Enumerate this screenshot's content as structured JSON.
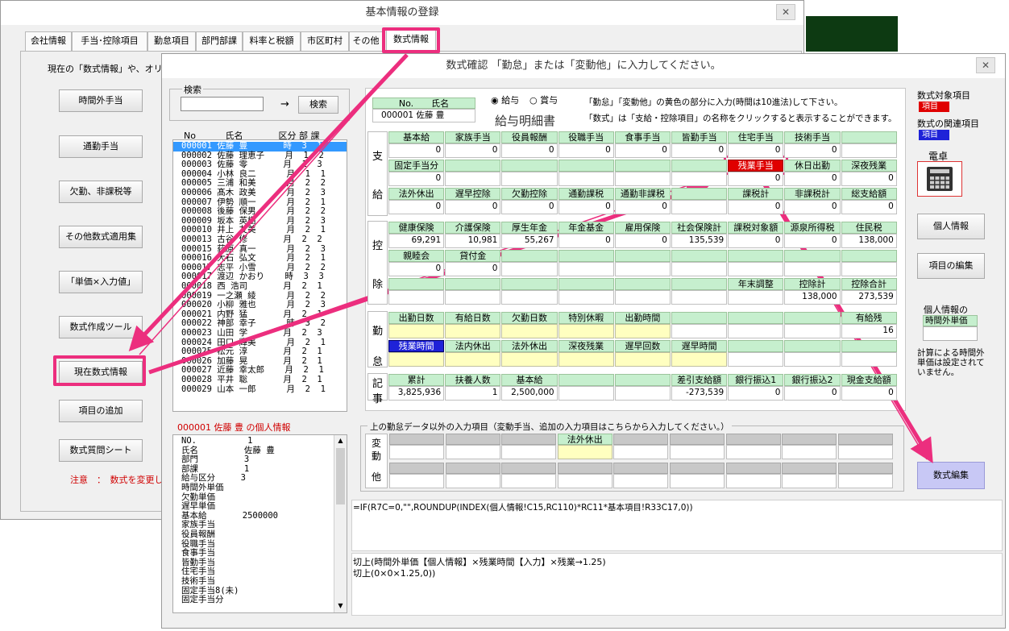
{
  "back_window": {
    "title": "基本情報の登録",
    "tabs": [
      "会社情報",
      "手当･控除項目",
      "勤怠項目",
      "部門部課",
      "料率と税額",
      "市区町村",
      "その他",
      "数式情報"
    ],
    "intro": "現在の「数式情報」や、オリジ",
    "buttons": [
      "時間外手当",
      "通勤手当",
      "欠勤、非課税等",
      "その他数式適用集",
      "｢単価×入力値｣",
      "数式作成ツール",
      "現在数式情報",
      "項目の追加",
      "数式質問シート"
    ],
    "note": "注意　：　数式を変更し"
  },
  "dialog": {
    "title": "数式確認 「勤怠」または「変動他」に入力してください。",
    "close": "✕",
    "search_label": "検索",
    "search_value": "",
    "arrow": "→",
    "search_button": "検索",
    "list_header": "No　　　 氏名　　　　区分 部 課",
    "employees": [
      "000001 佐藤 豊       時  3  1",
      "000002 佐藤 理恵子    月  1  2",
      "000003 佐藤 零       月  1  3",
      "000004 小林 良二      月  1  1",
      "000005 三浦 和美      月  2  2",
      "000006 髙木 政美      月  2  3",
      "000007 伊勢 順一      月  2  1",
      "000008 後藤 保男      月  2  2",
      "000009 坂本 英樹      月  2  3",
      "000010 井上 友美      月  2  1",
      "000013 古谷 修       月  2  2",
      "000015 荻原 真一      月  2  3",
      "000016 大石 弘文      月  2  1",
      "000017 志平 小雪      月  2  2",
      "000017 渡辺 かおり    時  3  3",
      "000018 西 浩司       月  2  1",
      "000019 一之瀬 綾      月  2  2",
      "000020 小柳 雅也      月  2  3",
      "000021 内野 猛       月  2  1",
      "000022 神部 幸子      時  3  2",
      "000023 山田 学       月  2  3",
      "000024 田口 輝美      月  2  1",
      "000025 松元 淳       月  2  1",
      "000026 加藤 晃       月  2  1",
      "000027 近藤 幸太郎    月  2  1",
      "000028 平井 聡       月  2  1",
      "000029 山本 一郎      月  2  1"
    ],
    "personal_title": "000001 佐藤 豊 の個人情報",
    "personal_rows": [
      "NO.          1",
      "氏名         佐藤 豊",
      "部門         3",
      "部課         1",
      "給与区分     3",
      "時間外単価",
      "欠勤単価",
      "遅早単価",
      "基本給       2500000",
      "家族手当",
      "役員報酬",
      "役職手当",
      "食事手当",
      "皆勤手当",
      "住宅手当",
      "技術手当",
      "固定手当8(未)",
      "固定手当分"
    ],
    "sheet": {
      "no_label": "No.　　氏名",
      "no_value": "000001 佐藤 豊",
      "radio_kyuyo": "給与",
      "radio_shoyo": "賞与",
      "payslip_title": "給与明細書",
      "instruction1": "「勤怠」「変動他」の黄色の部分に入力(時間は10進法)して下さい。",
      "instruction2": "「数式」は「支給・控除項目」の名称をクリックすると表示することができます。",
      "side_shikyu": [
        "支",
        "給"
      ],
      "side_kojo": [
        "控",
        "除"
      ],
      "side_kintai": [
        "勤",
        "怠"
      ],
      "side_kiji": [
        "記",
        "事"
      ],
      "pay_row1": [
        "基本給",
        "家族手当",
        "役員報酬",
        "役職手当",
        "食事手当",
        "皆勤手当",
        "住宅手当",
        "技術手当",
        ""
      ],
      "pay_val1": [
        "0",
        "0",
        "0",
        "0",
        "0",
        "0",
        "0",
        "0",
        ""
      ],
      "pay_row2": [
        "固定手当分",
        "",
        "",
        "",
        "",
        "",
        "残業手当",
        "休日出勤",
        "深夜残業"
      ],
      "pay_val2": [
        "0",
        "",
        "",
        "",
        "",
        "",
        "0",
        "0",
        "0"
      ],
      "pay_row3": [
        "法外休出",
        "遅早控除",
        "欠勤控除",
        "通勤課税",
        "通勤非課税",
        "",
        "課税計",
        "非課税計",
        "総支給額"
      ],
      "pay_val3": [
        "0",
        "0",
        "0",
        "0",
        "0",
        "",
        "0",
        "0",
        "0"
      ],
      "ded_row1": [
        "健康保険",
        "介護保険",
        "厚生年金",
        "年金基金",
        "雇用保険",
        "社会保険計",
        "課税対象額",
        "源泉所得税",
        "住民税"
      ],
      "ded_val1": [
        "69,291",
        "10,981",
        "55,267",
        "0",
        "0",
        "135,539",
        "0",
        "0",
        "138,000"
      ],
      "ded_row2": [
        "親睦会",
        "貸付金",
        "",
        "",
        "",
        "",
        "",
        "",
        ""
      ],
      "ded_val2": [
        "0",
        "0",
        "",
        "",
        "",
        "",
        "",
        "",
        ""
      ],
      "ded_row3": [
        "",
        "",
        "",
        "",
        "",
        "",
        "年末調整",
        "控除計",
        "控除合計"
      ],
      "ded_val3": [
        "",
        "",
        "",
        "",
        "",
        "",
        "",
        "138,000",
        "273,539"
      ],
      "att_row1": [
        "出勤日数",
        "有給日数",
        "欠勤日数",
        "特別休暇",
        "出勤時間",
        "",
        "",
        "",
        "有給残"
      ],
      "att_val1": [
        "",
        "",
        "",
        "",
        "",
        "",
        "",
        "",
        "16"
      ],
      "att_row2": [
        "残業時間",
        "法内休出",
        "法外休出",
        "深夜残業",
        "遅早回数",
        "遅早時間",
        "",
        "",
        ""
      ],
      "memo_row": [
        "累計",
        "扶養人数",
        "基本給",
        "",
        "",
        "差引支給額",
        "銀行振込1",
        "銀行振込2",
        "現金支給額"
      ],
      "memo_val": [
        "3,825,936",
        "1",
        "2,500,000",
        "",
        "",
        "-273,539",
        "0",
        "0",
        "0"
      ]
    },
    "hendo_title": "上の勤怠データ以外の入力項目（変動手当、追加の入力項目はこちらから入力してください。）",
    "hendo_side": [
      "変",
      "動",
      "他"
    ],
    "hendo_label": "法外休出",
    "formula": "=IF(R7C=0,\"\",ROUNDUP(INDEX(個人情報!C15,RC110)*RC11*基本項目!R33C17,0))",
    "explain1": "切上(時間外単価【個人情報】×残業時間【入力】×残業→1.25)",
    "explain2": "切上(0×0×1.25,0))",
    "right": {
      "target_label": "数式対象項目",
      "target_chip": "項目",
      "related_label": "数式の関連項目",
      "related_chip": "項目",
      "calc_label": "電卓",
      "btn_personal": "個人情報",
      "btn_edit_items": "項目の編集",
      "info_label": "個人情報の",
      "info_field": "時間外単価",
      "info_note": "計算による時間外単価は設定されていません。",
      "btn_formula_edit": "数式編集"
    }
  },
  "colors": {
    "highlight": "#ec2e7e",
    "green_cell": "#c6efce",
    "yellow_cell": "#ffffc0",
    "red_chip": "#e00000",
    "blue_chip": "#1e22d8",
    "formula_button": "#c8c8f5"
  }
}
